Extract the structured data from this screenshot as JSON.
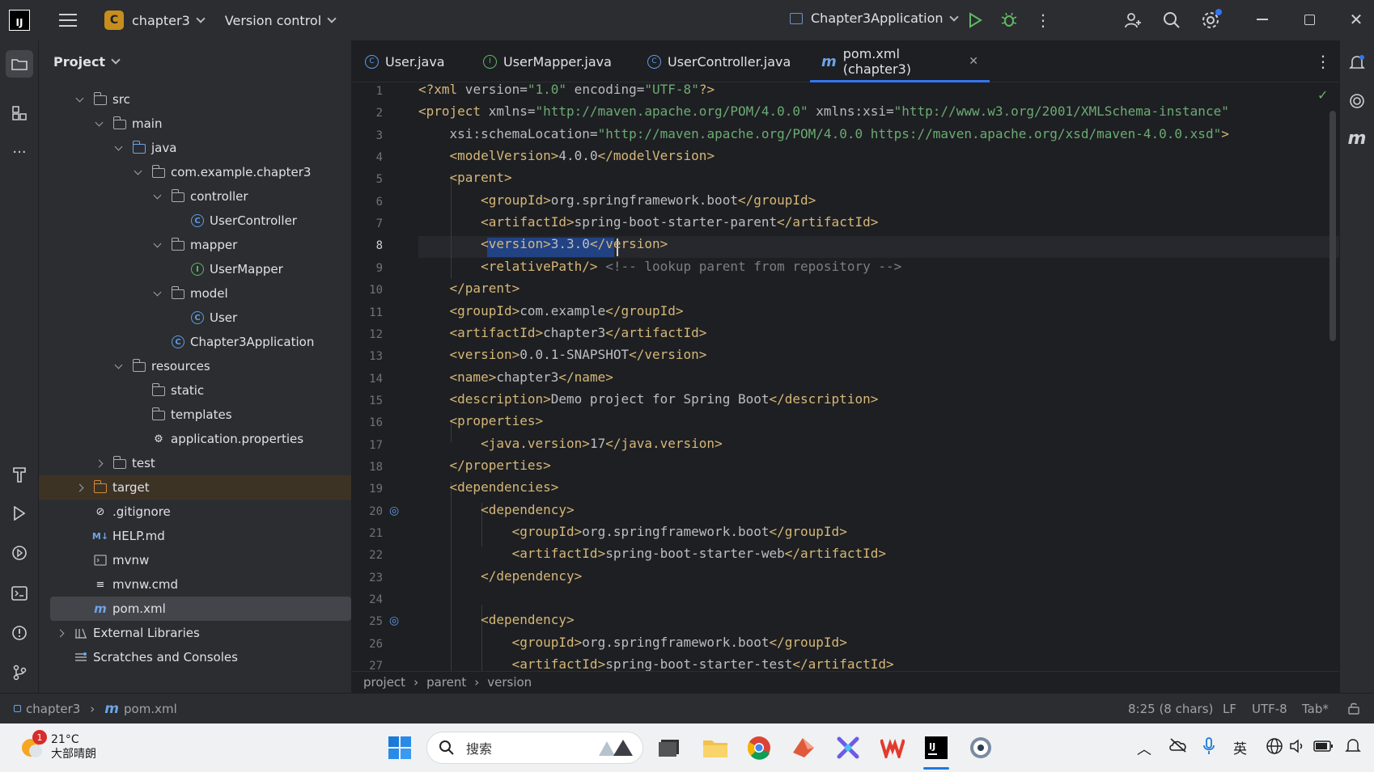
{
  "titlebar": {
    "project_letter": "C",
    "project_name": "chapter3",
    "vcs_label": "Version control",
    "run_config": "Chapter3Application"
  },
  "project_panel": {
    "title": "Project",
    "tree": [
      {
        "label": "src"
      },
      {
        "label": "main"
      },
      {
        "label": "java"
      },
      {
        "label": "com.example.chapter3"
      },
      {
        "label": "controller"
      },
      {
        "label": "UserController"
      },
      {
        "label": "mapper"
      },
      {
        "label": "UserMapper"
      },
      {
        "label": "model"
      },
      {
        "label": "User"
      },
      {
        "label": "Chapter3Application"
      },
      {
        "label": "resources"
      },
      {
        "label": "static"
      },
      {
        "label": "templates"
      },
      {
        "label": "application.properties"
      },
      {
        "label": "test"
      },
      {
        "label": "target"
      },
      {
        "label": ".gitignore"
      },
      {
        "label": "HELP.md"
      },
      {
        "label": "mvnw"
      },
      {
        "label": "mvnw.cmd"
      },
      {
        "label": "pom.xml"
      },
      {
        "label": "External Libraries"
      },
      {
        "label": "Scratches and Consoles"
      }
    ]
  },
  "tabs": [
    {
      "label": "User.java"
    },
    {
      "label": "UserMapper.java"
    },
    {
      "label": "UserController.java"
    },
    {
      "label": "pom.xml (chapter3)"
    }
  ],
  "editor": {
    "line_numbers": [
      "1",
      "2",
      "3",
      "4",
      "5",
      "6",
      "7",
      "8",
      "9",
      "10",
      "11",
      "12",
      "13",
      "14",
      "15",
      "16",
      "17",
      "18",
      "19",
      "20",
      "21",
      "22",
      "23",
      "24",
      "25",
      "26",
      "27"
    ],
    "lines": [
      "<?xml version=\"1.0\" encoding=\"UTF-8\"?>",
      "<project xmlns=\"http://maven.apache.org/POM/4.0.0\" xmlns:xsi=\"http://www.w3.org/2001/XMLSchema-instance\"",
      "    xsi:schemaLocation=\"http://maven.apache.org/POM/4.0.0 https://maven.apache.org/xsd/maven-4.0.0.xsd\">",
      "    <modelVersion>4.0.0</modelVersion>",
      "    <parent>",
      "        <groupId>org.springframework.boot</groupId>",
      "        <artifactId>spring-boot-starter-parent</artifactId>",
      "        <version>3.3.0</version>",
      "        <relativePath/> <!-- lookup parent from repository -->",
      "    </parent>",
      "    <groupId>com.example</groupId>",
      "    <artifactId>chapter3</artifactId>",
      "    <version>0.0.1-SNAPSHOT</version>",
      "    <name>chapter3</name>",
      "    <description>Demo project for Spring Boot</description>",
      "    <properties>",
      "        <java.version>17</java.version>",
      "    </properties>",
      "    <dependencies>",
      "        <dependency>",
      "            <groupId>org.springframework.boot</groupId>",
      "            <artifactId>spring-boot-starter-web</artifactId>",
      "        </dependency>",
      "",
      "        <dependency>",
      "            <groupId>org.springframework.boot</groupId>",
      "            <artifactId>spring-boot-starter-test</artifactId>"
    ]
  },
  "breadcrumbs": [
    "project",
    "parent",
    "version"
  ],
  "statusbar": {
    "project": "chapter3",
    "file": "pom.xml",
    "position": "8:25 (8 chars)",
    "line_sep": "LF",
    "encoding": "UTF-8",
    "indent": "Tab*"
  },
  "taskbar": {
    "weather_temp": "21°C",
    "weather_desc": "大部晴朗",
    "weather_badge": "1",
    "search_placeholder": "搜索",
    "lang": "英"
  },
  "colors": {
    "accent": "#3574f0",
    "tag": "#d5b778",
    "attr": "#bababa",
    "string": "#6aab73",
    "comment": "#7a7e85",
    "text": "#bcbec4"
  }
}
